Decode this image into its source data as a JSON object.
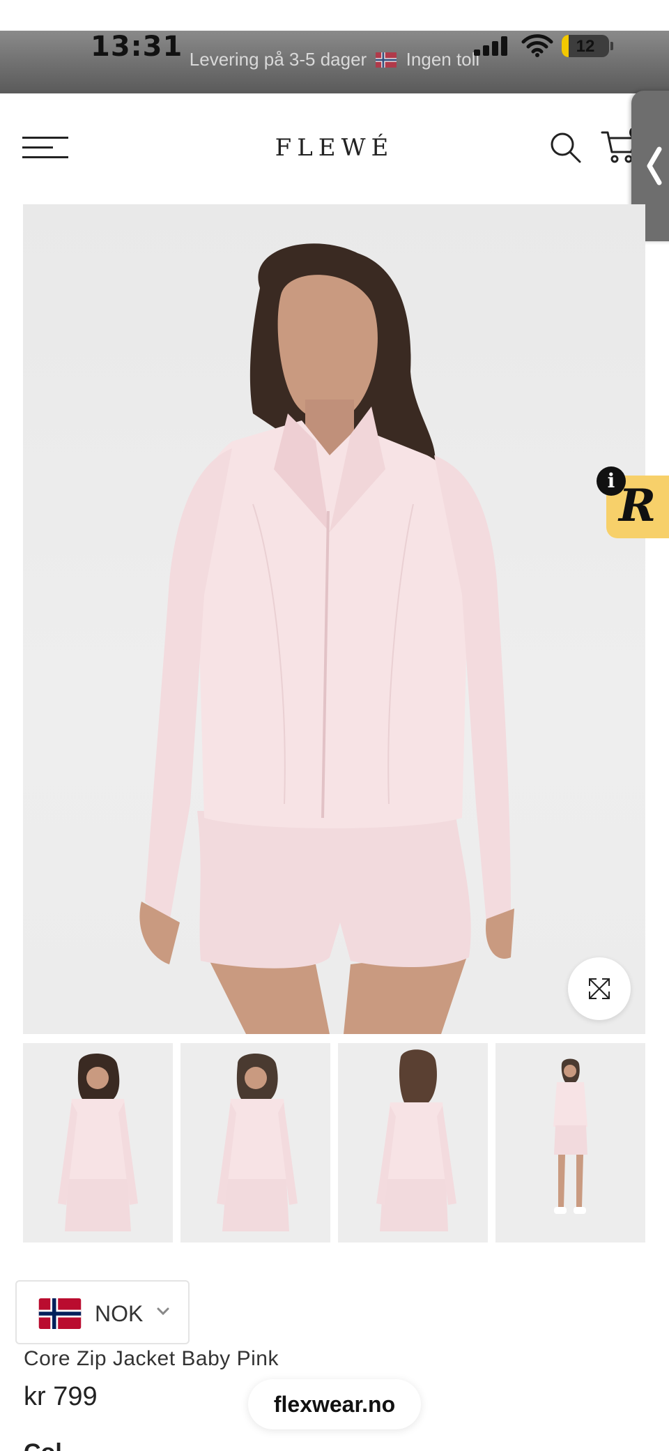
{
  "status_bar": {
    "time": "13:31",
    "battery": "12",
    "battery_percent": 12,
    "announcement_before_flag": "Levering på 3-5 dager",
    "announcement_after_flag": "Ingen toll"
  },
  "header": {
    "logo": "FLEWÉ"
  },
  "product": {
    "title": "Core Zip Jacket Baby Pink",
    "price": "kr 799",
    "thumbnail_count": 4,
    "selected_thumbnail": 1
  },
  "currency": {
    "code": "NOK"
  },
  "browser": {
    "domain": "flexwear.no"
  },
  "badges": {
    "review_badge_letter": "R",
    "info_letter": "i"
  },
  "partial": {
    "next_section_label": "Col"
  },
  "colors": {
    "accent": "#f7d06a",
    "jacket_pink": "#f7e1e3",
    "text_dark": "#222222",
    "flag_red": "#ba0c2f",
    "flag_blue": "#00205b"
  },
  "icons": {
    "menu": "hamburger-icon",
    "search": "search-icon",
    "cart": "cart-icon",
    "side_tab": "chevron-left-icon",
    "expand": "expand-icon",
    "currency_dropdown": "chevron-down-icon"
  }
}
